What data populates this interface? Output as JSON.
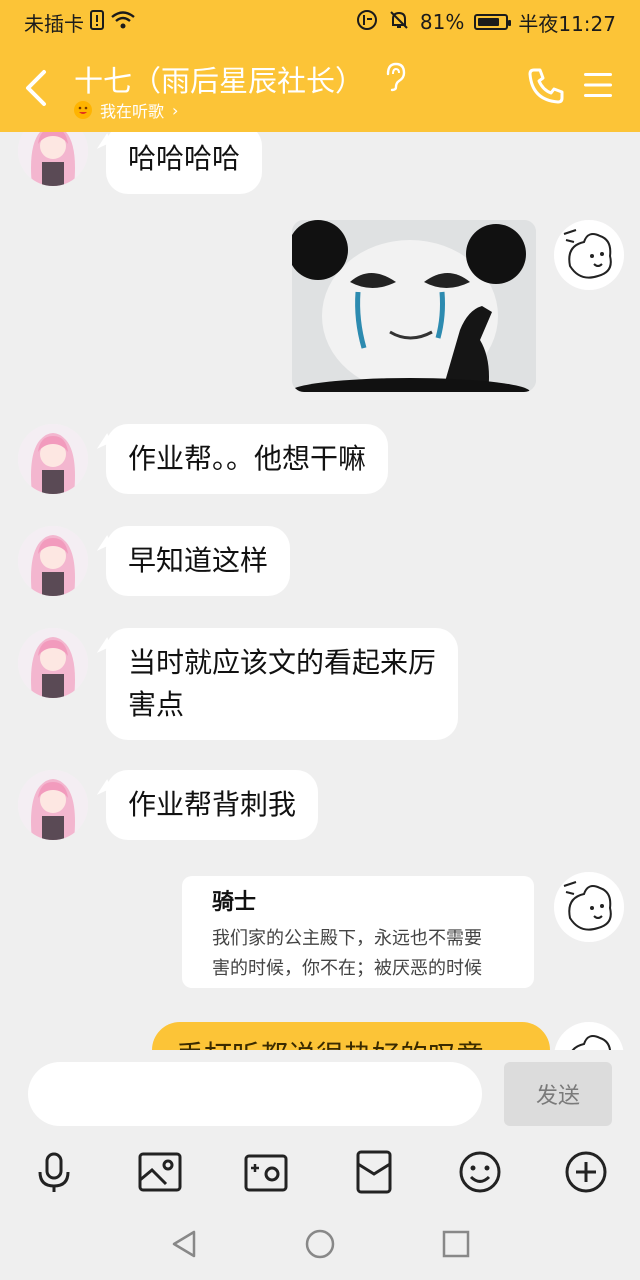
{
  "status_bar": {
    "carrier": "未插卡",
    "battery_percent": "81%",
    "battery_level": 0.81,
    "time": "半夜11:27"
  },
  "header": {
    "title": "十七（雨后星辰社长）",
    "subtitle": "我在听歌",
    "subtitle_chevron": "›"
  },
  "messages": [
    {
      "side": "left",
      "text": "哈哈哈哈"
    },
    {
      "side": "right",
      "type": "image",
      "icon": "crying-panda-sticker"
    },
    {
      "side": "left",
      "text": "作业帮。。他想干嘛"
    },
    {
      "side": "left",
      "text": "早知道这样"
    },
    {
      "side": "left",
      "line1": "当时就应该文的看起来厉",
      "line2": "害点"
    },
    {
      "side": "left",
      "text": "作业帮背刺我"
    },
    {
      "side": "right",
      "type": "card",
      "title": "骑士",
      "line1": "我们家的公主殿下，永远也不需要",
      "line2": "害的时候，你不在；被厌恶的时候"
    },
    {
      "side": "right",
      "type": "text-partial",
      "text": "丢打听都说很热好的叹意"
    }
  ],
  "input": {
    "placeholder": "",
    "send_label": "发送"
  },
  "tools": [
    "microphone-icon",
    "image-icon",
    "camera-icon",
    "red-packet-icon",
    "emoji-icon",
    "plus-icon"
  ],
  "colors": {
    "accent": "#fcc437",
    "background": "#efefef",
    "bubble": "#ffffff"
  }
}
